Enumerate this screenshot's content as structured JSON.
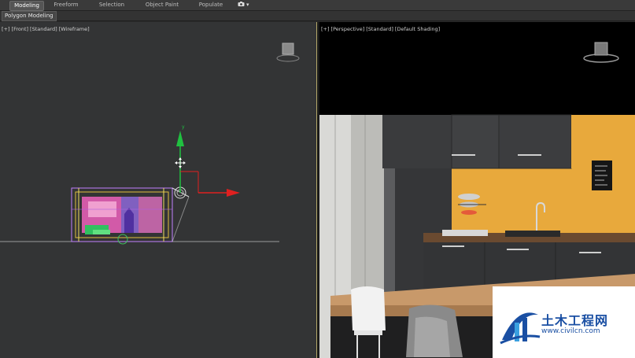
{
  "ribbon": {
    "tabs": [
      "Modeling",
      "Freeform",
      "Selection",
      "Object Paint",
      "Populate"
    ],
    "active_tab": "Modeling",
    "sub_tab": "Polygon Modeling",
    "more_icon": "camera-icon",
    "more_arrow": "▾"
  },
  "viewports": {
    "front": {
      "brackets": [
        "[+]",
        "[Front]",
        "[Standard]",
        "[Wireframe]"
      ]
    },
    "perspective": {
      "brackets": [
        "[+]",
        "[Perspective]",
        "[Standard]",
        "[Default Shading]"
      ]
    }
  },
  "watermark": {
    "title": "土木工程网",
    "url": "www.civilcn.com"
  },
  "colors": {
    "accent_wall": "#e8a93c",
    "cabinet": "#3a3b3d",
    "axis_x": "#e02020",
    "axis_y": "#20c040",
    "brand_blue": "#1a4fa3"
  }
}
